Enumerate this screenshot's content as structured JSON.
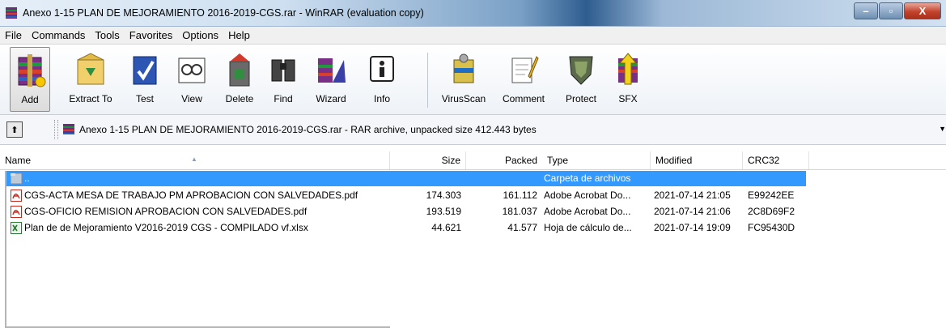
{
  "window": {
    "title": "Anexo 1-15  PLAN DE MEJORAMIENTO 2016-2019-CGS.rar - WinRAR (evaluation copy)",
    "minimize": "–",
    "maximize": "▫",
    "close": "X"
  },
  "menu": [
    "File",
    "Commands",
    "Tools",
    "Favorites",
    "Options",
    "Help"
  ],
  "toolbar": {
    "buttons": [
      {
        "label": "Add",
        "icon": "add-icon"
      },
      {
        "label": "Extract To",
        "icon": "extract-icon"
      },
      {
        "label": "Test",
        "icon": "test-icon"
      },
      {
        "label": "View",
        "icon": "view-icon"
      },
      {
        "label": "Delete",
        "icon": "delete-icon"
      },
      {
        "label": "Find",
        "icon": "find-icon"
      },
      {
        "label": "Wizard",
        "icon": "wizard-icon"
      },
      {
        "label": "Info",
        "icon": "info-icon"
      },
      {
        "label": "VirusScan",
        "icon": "virusscan-icon"
      },
      {
        "label": "Comment",
        "icon": "comment-icon"
      },
      {
        "label": "Protect",
        "icon": "protect-icon"
      },
      {
        "label": "SFX",
        "icon": "sfx-icon"
      }
    ]
  },
  "address": {
    "up_label": "⬆",
    "text": "Anexo 1-15  PLAN DE MEJORAMIENTO 2016-2019-CGS.rar - RAR archive, unpacked size 412.443 bytes",
    "dropdown": "▼"
  },
  "columns": {
    "name": "Name",
    "size": "Size",
    "packed": "Packed",
    "type": "Type",
    "modified": "Modified",
    "crc": "CRC32",
    "sort_indicator": "▲"
  },
  "files": [
    {
      "name": "..",
      "size": "",
      "packed": "",
      "type": "Carpeta de archivos",
      "modified": "",
      "crc": "",
      "icon": "folder-icon",
      "selected": true
    },
    {
      "name": "CGS-ACTA MESA DE TRABAJO PM APROBACION CON SALVEDADES.pdf",
      "size": "174.303",
      "packed": "161.112",
      "type": "Adobe Acrobat Do...",
      "modified": "2021-07-14 21:05",
      "crc": "E99242EE",
      "icon": "pdf-icon",
      "selected": false
    },
    {
      "name": "CGS-OFICIO REMISION APROBACION CON SALVEDADES.pdf",
      "size": "193.519",
      "packed": "181.037",
      "type": "Adobe Acrobat Do...",
      "modified": "2021-07-14 21:06",
      "crc": "2C8D69F2",
      "icon": "pdf-icon",
      "selected": false
    },
    {
      "name": "Plan de de Mejoramiento V2016-2019 CGS - COMPILADO vf.xlsx",
      "size": "44.621",
      "packed": "41.577",
      "type": "Hoja de cálculo de...",
      "modified": "2021-07-14 19:09",
      "crc": "FC95430D",
      "icon": "excel-icon",
      "selected": false
    }
  ],
  "colors": {
    "selection": "#3399ff",
    "accent": "#2e5d8f"
  }
}
